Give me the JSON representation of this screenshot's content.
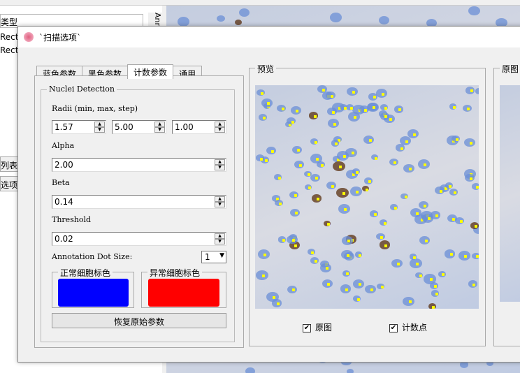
{
  "background": {
    "list_header": "类型",
    "list_rows": [
      "Rect",
      "Rect"
    ],
    "side_tabs": [
      "列表",
      "选项"
    ],
    "vertical_tab": "Ann"
  },
  "dialog": {
    "title": "`扫描选项`",
    "tabs": [
      {
        "label": "蓝色参数",
        "active": false
      },
      {
        "label": "黑色参数",
        "active": false
      },
      {
        "label": "计数参数",
        "active": true
      },
      {
        "label": "通用",
        "active": false
      }
    ],
    "nuclei": {
      "group_label": "Nuclei Detection",
      "radii_label": "Radii (min, max, step)",
      "radii_min": "1.57",
      "radii_max": "5.00",
      "radii_step": "1.00",
      "alpha_label": "Alpha",
      "alpha": "2.00",
      "beta_label": "Beta",
      "beta": "0.14",
      "threshold_label": "Threshold",
      "threshold": "0.02",
      "dot_size_label": "Annotation Dot Size:",
      "dot_size": "1",
      "normal_color_label": "正常细胞标色",
      "normal_color": "#0000ff",
      "abnormal_color_label": "异常细胞标色",
      "abnormal_color": "#ff0000",
      "reset_label": "恢复原始参数"
    },
    "preview": {
      "label": "预览",
      "show_original_label": "原图",
      "show_original": true,
      "show_count_label": "计数点",
      "show_count": true
    },
    "original": {
      "label": "原图"
    }
  },
  "colors": {
    "count_dot": "#ffff00",
    "nucleus_blue": "#6b8fd6",
    "nucleus_brown": "#5a3010"
  }
}
